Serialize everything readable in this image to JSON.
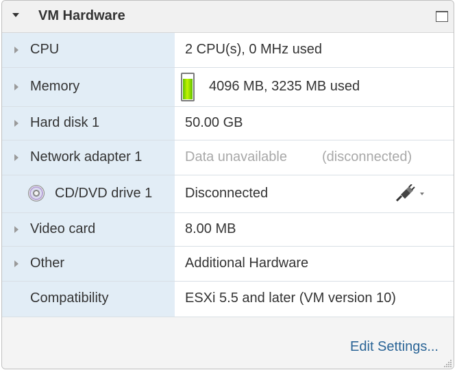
{
  "panel": {
    "title": "VM Hardware"
  },
  "rows": [
    {
      "label": "CPU",
      "value": "2 CPU(s), 0 MHz used"
    },
    {
      "label": "Memory",
      "value": "4096 MB, 3235 MB used",
      "memory_used_fraction": 0.79
    },
    {
      "label": "Hard disk 1",
      "value": "50.00 GB"
    },
    {
      "label": "Network adapter 1",
      "value": "Data unavailable",
      "value_note": "(disconnected)"
    },
    {
      "label": "CD/DVD drive 1",
      "value": "Disconnected",
      "icon": "cd-dvd-icon",
      "action_icon": "connect-plug-icon"
    },
    {
      "label": "Video card",
      "value": "8.00 MB"
    },
    {
      "label": "Other",
      "value": "Additional Hardware"
    },
    {
      "label": "Compatibility",
      "value": "ESXi 5.5 and later (VM version 10)"
    }
  ],
  "footer": {
    "edit_settings": "Edit Settings..."
  },
  "colors": {
    "label_bg": "#e2edf6",
    "link": "#2a6496",
    "memory_bar": "#8ee000"
  }
}
